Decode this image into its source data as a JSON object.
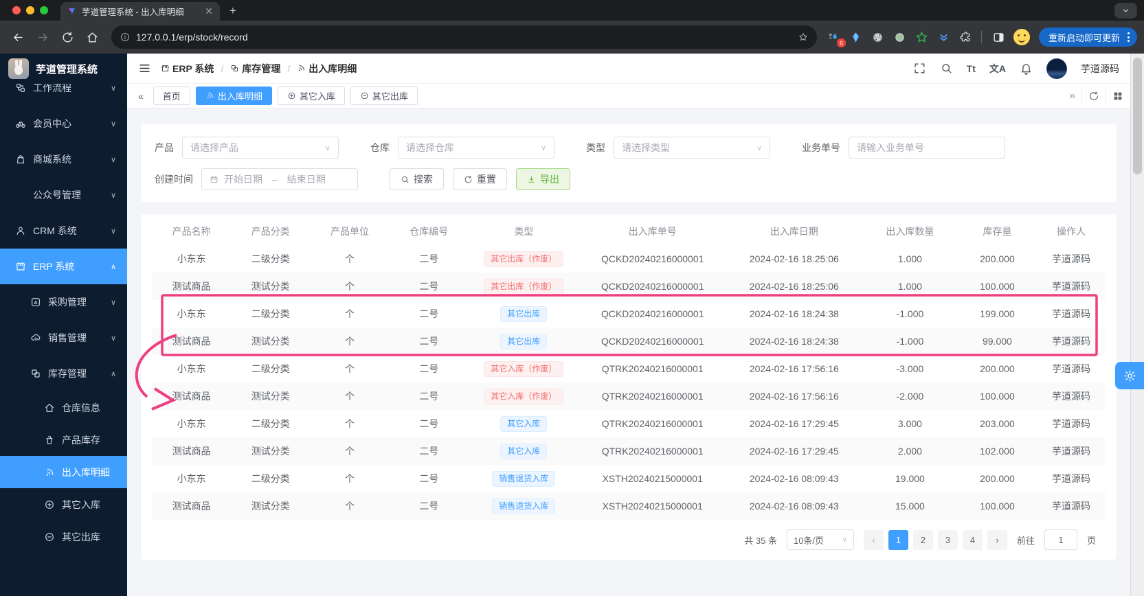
{
  "theme": {
    "accent": "#409eff",
    "danger": "#f56c6c",
    "success": "#58b331",
    "annotation_pink": "#ee3f80",
    "sidebar_bg": "#0e1c30"
  },
  "browser": {
    "tab_title": "芋道管理系统 - 出入库明细",
    "url": "127.0.0.1/erp/stock/record",
    "update_button": "重新启动即可更新",
    "extension_badge": "6",
    "extensions": [
      "pixel-drop",
      "gem",
      "camera",
      "green-dot",
      "green-star",
      "double-chevron",
      "puzzle"
    ]
  },
  "sidebar": {
    "app_title": "芋道管理系统",
    "items": [
      {
        "label": "工作流程",
        "icon": "workflow",
        "level": 1,
        "chevron": "down",
        "active": false
      },
      {
        "label": "会员中心",
        "icon": "member",
        "level": 1,
        "chevron": "down",
        "active": false
      },
      {
        "label": "商城系统",
        "icon": "mall",
        "level": 1,
        "chevron": "down",
        "active": false
      },
      {
        "label": "公众号管理",
        "icon": "",
        "level": 2,
        "chevron": "down",
        "active": false
      },
      {
        "label": "CRM 系统",
        "icon": "crm",
        "level": 1,
        "chevron": "down",
        "active": false
      },
      {
        "label": "ERP 系统",
        "icon": "erp",
        "level": 1,
        "chevron": "up",
        "active": true
      },
      {
        "label": "采购管理",
        "icon": "purchase",
        "level": 2,
        "chevron": "down",
        "active": false
      },
      {
        "label": "销售管理",
        "icon": "sales",
        "level": 2,
        "chevron": "down",
        "active": false
      },
      {
        "label": "库存管理",
        "icon": "stock",
        "level": 2,
        "chevron": "up",
        "active": false
      },
      {
        "label": "仓库信息",
        "icon": "warehouse",
        "level": 3,
        "chevron": "",
        "active": false
      },
      {
        "label": "产品库存",
        "icon": "product",
        "level": 3,
        "chevron": "",
        "active": false
      },
      {
        "label": "出入库明细",
        "icon": "record-detail",
        "level": 3,
        "chevron": "",
        "active": true
      },
      {
        "label": "其它入库",
        "icon": "stock-in",
        "level": 3,
        "chevron": "",
        "active": false
      },
      {
        "label": "其它出库",
        "icon": "stock-out",
        "level": 3,
        "chevron": "",
        "active": false
      }
    ]
  },
  "header": {
    "breadcrumb": [
      {
        "label": "ERP 系统",
        "icon": "erp"
      },
      {
        "label": "库存管理",
        "icon": "stock"
      },
      {
        "label": "出入库明细",
        "icon": "record-detail"
      }
    ],
    "font_size_icon_text": "Tt",
    "translate_icon_text": "文A",
    "username": "芋道源码"
  },
  "tabbar": {
    "tabs": [
      {
        "label": "首页",
        "icon": "",
        "active": false
      },
      {
        "label": "出入库明细",
        "icon": "record-detail",
        "active": true
      },
      {
        "label": "其它入库",
        "icon": "stock-in",
        "active": false
      },
      {
        "label": "其它出库",
        "icon": "stock-out",
        "active": false
      }
    ]
  },
  "filters": {
    "product_label": "产品",
    "product_placeholder": "请选择产品",
    "warehouse_label": "仓库",
    "warehouse_placeholder": "请选择仓库",
    "type_label": "类型",
    "type_placeholder": "请选择类型",
    "biz_no_label": "业务单号",
    "biz_no_placeholder": "请输入业务单号",
    "time_label": "创建时间",
    "time_start_placeholder": "开始日期",
    "time_separator": "–",
    "time_end_placeholder": "结束日期",
    "search_button": "搜索",
    "reset_button": "重置",
    "export_button": "导出"
  },
  "table": {
    "columns": [
      "产品名称",
      "产品分类",
      "产品单位",
      "仓库编号",
      "类型",
      "出入库单号",
      "出入库日期",
      "出入库数量",
      "库存量",
      "操作人"
    ],
    "col_widths": [
      "8.3%",
      "8.3%",
      "8.3%",
      "8.3%",
      "11.6%",
      "15.4%",
      "14.3%",
      "10%",
      "8.3%",
      "7.2%"
    ],
    "rows": [
      {
        "product": "小东东",
        "category": "二级分类",
        "unit": "个",
        "warehouse": "二号",
        "type": "其它出库（作废）",
        "type_style": "danger",
        "order_no": "QCKD20240216000001",
        "date": "2024-02-16 18:25:06",
        "quantity": "1.000",
        "stock": "200.000",
        "operator": "芋道源码"
      },
      {
        "product": "测试商品",
        "category": "测试分类",
        "unit": "个",
        "warehouse": "二号",
        "type": "其它出库（作废）",
        "type_style": "danger",
        "order_no": "QCKD20240216000001",
        "date": "2024-02-16 18:25:06",
        "quantity": "1.000",
        "stock": "100.000",
        "operator": "芋道源码"
      },
      {
        "product": "小东东",
        "category": "二级分类",
        "unit": "个",
        "warehouse": "二号",
        "type": "其它出库",
        "type_style": "primary",
        "order_no": "QCKD20240216000001",
        "date": "2024-02-16 18:24:38",
        "quantity": "-1.000",
        "stock": "199.000",
        "operator": "芋道源码"
      },
      {
        "product": "测试商品",
        "category": "测试分类",
        "unit": "个",
        "warehouse": "二号",
        "type": "其它出库",
        "type_style": "primary",
        "order_no": "QCKD20240216000001",
        "date": "2024-02-16 18:24:38",
        "quantity": "-1.000",
        "stock": "99.000",
        "operator": "芋道源码"
      },
      {
        "product": "小东东",
        "category": "二级分类",
        "unit": "个",
        "warehouse": "二号",
        "type": "其它入库（作废）",
        "type_style": "danger",
        "order_no": "QTRK20240216000001",
        "date": "2024-02-16 17:56:16",
        "quantity": "-3.000",
        "stock": "200.000",
        "operator": "芋道源码"
      },
      {
        "product": "测试商品",
        "category": "测试分类",
        "unit": "个",
        "warehouse": "二号",
        "type": "其它入库（作废）",
        "type_style": "danger",
        "order_no": "QTRK20240216000001",
        "date": "2024-02-16 17:56:16",
        "quantity": "-2.000",
        "stock": "100.000",
        "operator": "芋道源码"
      },
      {
        "product": "小东东",
        "category": "二级分类",
        "unit": "个",
        "warehouse": "二号",
        "type": "其它入库",
        "type_style": "primary",
        "order_no": "QTRK20240216000001",
        "date": "2024-02-16 17:29:45",
        "quantity": "3.000",
        "stock": "203.000",
        "operator": "芋道源码"
      },
      {
        "product": "测试商品",
        "category": "测试分类",
        "unit": "个",
        "warehouse": "二号",
        "type": "其它入库",
        "type_style": "primary",
        "order_no": "QTRK20240216000001",
        "date": "2024-02-16 17:29:45",
        "quantity": "2.000",
        "stock": "102.000",
        "operator": "芋道源码"
      },
      {
        "product": "小东东",
        "category": "二级分类",
        "unit": "个",
        "warehouse": "二号",
        "type": "销售退货入库",
        "type_style": "primary",
        "order_no": "XSTH20240215000001",
        "date": "2024-02-16 08:09:43",
        "quantity": "19.000",
        "stock": "200.000",
        "operator": "芋道源码"
      },
      {
        "product": "测试商品",
        "category": "测试分类",
        "unit": "个",
        "warehouse": "二号",
        "type": "销售退货入库",
        "type_style": "primary",
        "order_no": "XSTH20240215000001",
        "date": "2024-02-16 08:09:43",
        "quantity": "15.000",
        "stock": "100.000",
        "operator": "芋道源码"
      }
    ]
  },
  "pagination": {
    "total": "共 35 条",
    "page_size": "10条/页",
    "pages": [
      "1",
      "2",
      "3",
      "4"
    ],
    "active_page": "1",
    "jump_label": "前往",
    "jump_value": "1",
    "jump_unit": "页"
  }
}
